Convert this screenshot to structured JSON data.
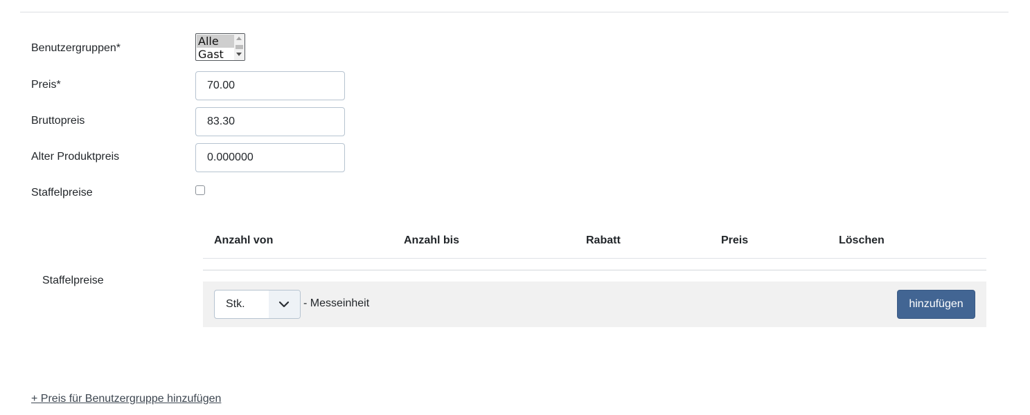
{
  "form": {
    "user_groups": {
      "label": "Benutzergruppen*",
      "options": [
        "Alle",
        "Gast"
      ],
      "selected": "Alle"
    },
    "price": {
      "label": "Preis*",
      "value": "70.00"
    },
    "gross_price": {
      "label": "Bruttopreis",
      "value": "83.30"
    },
    "old_price": {
      "label": "Alter Produktpreis",
      "value": "0.000000"
    },
    "tier_toggle": {
      "label": "Staffelpreise",
      "checked": false
    }
  },
  "tiers": {
    "label": "Staffelpreise",
    "columns": [
      "Anzahl von",
      "Anzahl bis",
      "Rabatt",
      "Preis",
      "Löschen"
    ],
    "rows": [],
    "unit_select": {
      "value": "Stk."
    },
    "unit_suffix": "- Messeinheit",
    "add_button": "hinzufügen"
  },
  "add_group_link": "+ Preis für Benutzergruppe hinzufügen"
}
